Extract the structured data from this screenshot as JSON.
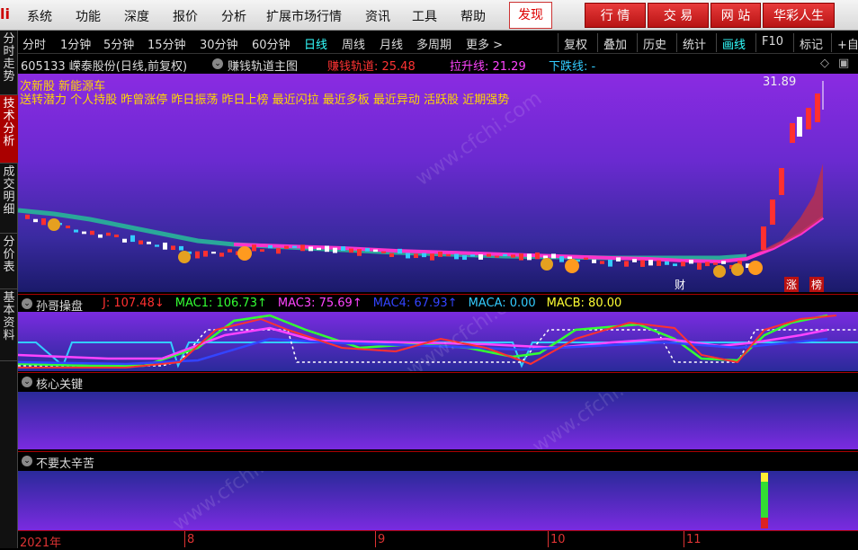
{
  "menu": {
    "logo": "li",
    "items": [
      "系统",
      "功能",
      "深度",
      "报价",
      "分析",
      "扩展市场行情",
      "资讯",
      "工具",
      "帮助"
    ],
    "discover": "发现",
    "right_buttons": [
      "行 情",
      "交 易",
      "网 站",
      "华彩人生"
    ]
  },
  "sidebar": {
    "tabs": [
      "分时走势",
      "技术分析",
      "成交明细",
      "分价表",
      "基本资料"
    ],
    "active_index": 1
  },
  "periods": {
    "items": [
      "分时",
      "1分钟",
      "5分钟",
      "15分钟",
      "30分钟",
      "60分钟",
      "日线",
      "周线",
      "月线",
      "多周期",
      "更多 >"
    ],
    "active": "日线"
  },
  "tools": {
    "items": [
      "复权",
      "叠加",
      "历史",
      "统计",
      "画线",
      "F10",
      "标记",
      "+自"
    ],
    "active": "画线"
  },
  "stock": {
    "code_name": "605133 嵘泰股份(日线,前复权)",
    "indicator": "赚钱轨道主图",
    "line1_label": "赚钱轨道: 25.48",
    "line2_label": "拉升线: 21.29",
    "line3_label": "下跌线: -",
    "high_label": "31.89",
    "headline1": "次新股 新能源车",
    "headline2": "送转潜力 个人持股 昨曾涨停 昨日振荡 昨日上榜 最近闪拉 最近多板 最近异动 活跃股 近期强势",
    "tags": [
      "财",
      "涨",
      "榜"
    ]
  },
  "panel2": {
    "name": "孙哥操盘",
    "values": [
      {
        "label": "J: 107.48",
        "arrow": "↓",
        "color": "#ff3030"
      },
      {
        "label": "MAC1: 106.73",
        "arrow": "↑",
        "color": "#33ff33"
      },
      {
        "label": "MAC3: 75.69",
        "arrow": "↑",
        "color": "#ff44ff"
      },
      {
        "label": "MAC4: 67.93",
        "arrow": "↑",
        "color": "#3344ff"
      },
      {
        "label": "MACA: 0.00",
        "arrow": "",
        "color": "#33ccff"
      },
      {
        "label": "MACB: 80.00",
        "arrow": "",
        "color": "#ffff33"
      }
    ]
  },
  "panel3": {
    "name": "核心关键"
  },
  "panel4": {
    "name": "不要太辛苦"
  },
  "time_axis": {
    "labels": [
      "2021年",
      "8",
      "9",
      "10",
      "11"
    ]
  },
  "watermark": "www.cfchi.com",
  "colors": {
    "accent_red": "#cc0000",
    "active_cyan": "#33ffff",
    "headline_yellow": "#ffd700"
  }
}
